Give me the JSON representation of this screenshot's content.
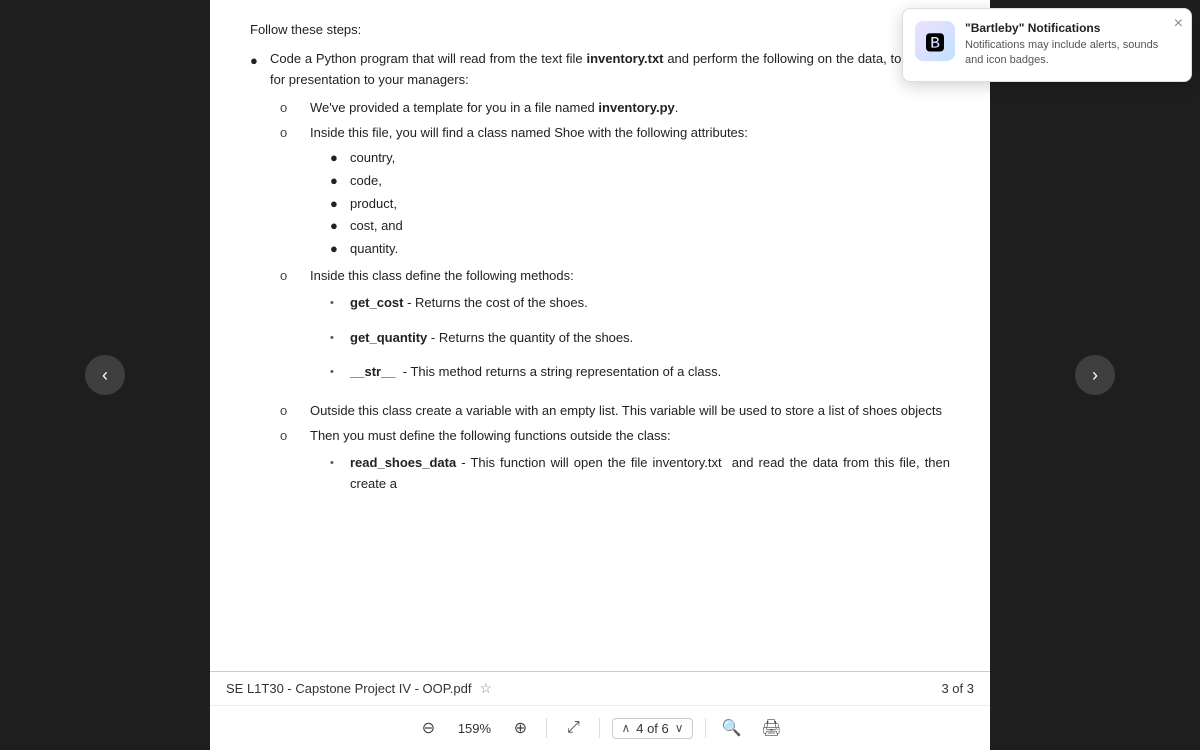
{
  "notification": {
    "title": "\"Bartleby\" Notifications",
    "body": "Notifications may include alerts, sounds and icon badges.",
    "icon": "🅱",
    "close_label": "×"
  },
  "nav": {
    "left_arrow": "‹",
    "right_arrow": "›"
  },
  "pdf": {
    "filename": "SE L1T30 - Capstone Project IV - OOP.pdf",
    "page_count": "3 of 3",
    "zoom": "159%",
    "page_nav": "4 of 6",
    "steps_header": "Follow these steps:",
    "main_bullet": "Code a Python program that will read from the text file",
    "inventory_txt": "inventory.txt",
    "main_bullet_cont": "and perform the following on the data, to prepare for presentation to your managers:",
    "sub_items": [
      {
        "prefix": "o",
        "text_before": "We've provided a template for you in a file named",
        "bold": "inventory.py",
        "text_after": "."
      },
      {
        "prefix": "o",
        "text": "Inside this file, you will find a class named Shoe with the following attributes:",
        "bullets": [
          "country,",
          "code,",
          "product,",
          "cost, and",
          "quantity."
        ]
      },
      {
        "prefix": "o",
        "text": "Inside this class define the following methods:",
        "methods": [
          {
            "name": "get_cost",
            "desc": "- Returns the cost of the shoes."
          },
          {
            "name": "get_quantity",
            "desc": "- Returns the quantity of the shoes."
          },
          {
            "name": "__str__",
            "desc": "- This method returns a string representation of a class."
          }
        ]
      },
      {
        "prefix": "o",
        "text": "Outside this class create a variable with an empty list. This variable will be used to store a list of shoes objects"
      },
      {
        "prefix": "o",
        "text": "Then you must define the following functions outside the class:",
        "methods": [
          {
            "name": "read_shoes_data",
            "desc": "-  This function will open the file inventory.txt  and read the data from this file, then create a"
          }
        ]
      }
    ]
  },
  "toolbar": {
    "filename_label": "SE L1T30 - Capstone Project IV - OOP.pdf",
    "page_count_label": "3 of 3",
    "zoom_label": "159%",
    "page_nav_label": "4 of 6",
    "zoom_minus": "−",
    "zoom_plus": "+",
    "fit_icon": "⤢",
    "page_up": "∧",
    "page_down": "∨",
    "search_icon": "🔍",
    "print_icon": "🖨"
  }
}
